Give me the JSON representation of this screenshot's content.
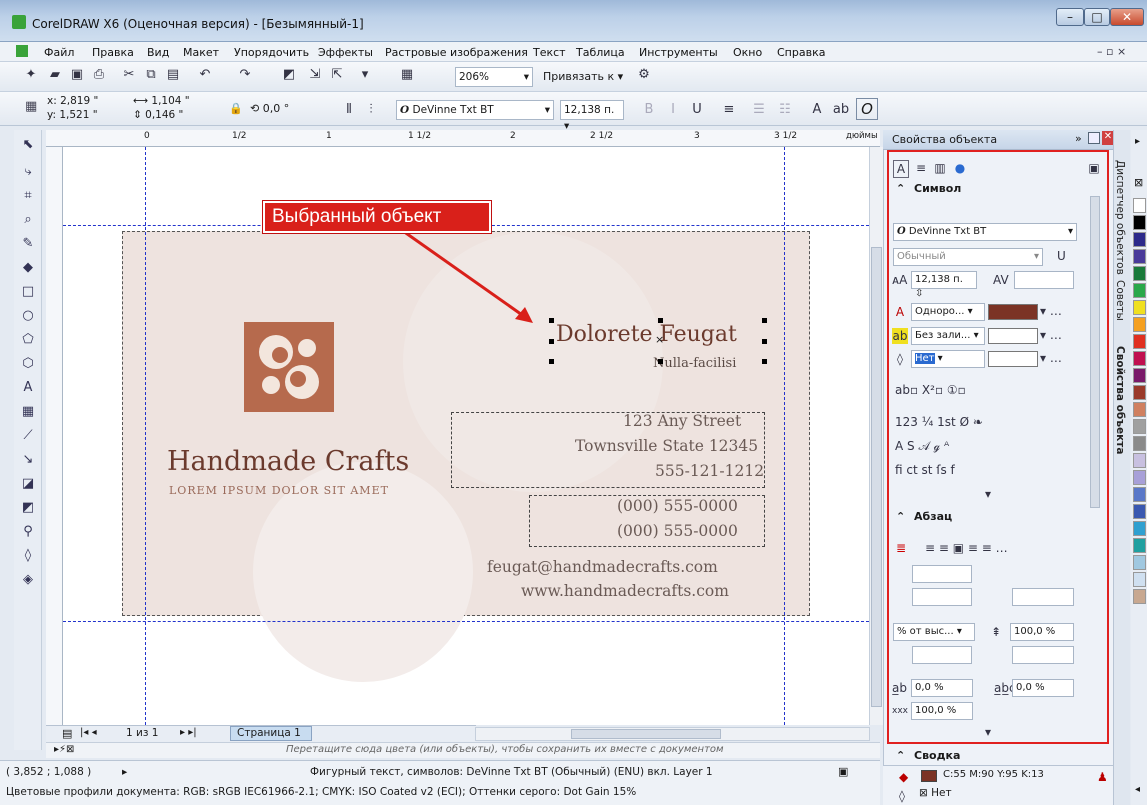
{
  "window": {
    "title": "CorelDRAW X6 (Оценочная версия) - [Безымянный-1]"
  },
  "menu": [
    "Файл",
    "Правка",
    "Вид",
    "Макет",
    "Упорядочить",
    "Эффекты",
    "Растровые изображения",
    "Текст",
    "Таблица",
    "Инструменты",
    "Окно",
    "Справка"
  ],
  "toolbar": {
    "zoom": "206%",
    "snap": "Привязать к"
  },
  "propbar": {
    "x": "x: 2,819 \"",
    "y": "y: 1,521 \"",
    "w": "1,104 \"",
    "h": "0,146 \"",
    "angle": "0,0",
    "font": "DeVinne Txt BT",
    "size": "12,138 п."
  },
  "ruler": {
    "units": "дюймы",
    "ticks": [
      "0",
      "1/2",
      "1",
      "1 1/2",
      "2",
      "2 1/2",
      "3",
      "3 1/2"
    ]
  },
  "card": {
    "name": "Dolorete Feugat",
    "tagline": "Nulla-facilisi",
    "brand": "Handmade Crafts",
    "brand_sub": "LOREM IPSUM DOLOR SIT AMET",
    "street": "123 Any Street",
    "city": "Townsville State 12345",
    "phone1": "555-121-1212",
    "phone2": "(000) 555-0000",
    "phone3": "(000) 555-0000",
    "email": "feugat@handmadecrafts.com",
    "web": "www.handmadecrafts.com"
  },
  "callout": "Выбранный объект",
  "pages": {
    "counter": "1 из 1",
    "tab": "Страница 1"
  },
  "palette_hint": "Перетащите сюда цвета (или объекты), чтобы сохранить их вместе с документом",
  "status": {
    "coords": "( 3,852 ; 1,088 )",
    "object": "Фигурный текст, символов: DeVinne Txt BT (Обычный) (ENU) вкл. Layer 1",
    "profiles": "Цветовые профили документа: RGB: sRGB IEC61966-2.1; CMYK: ISO Coated v2 (ECI); Оттенки серого: Dot Gain 15%",
    "fill": "C:55 M:90 Y:95 K:13",
    "outline": "Нет"
  },
  "panel": {
    "title": "Свойства объекта",
    "section_char": "Символ",
    "font": "DeVinne Txt BT",
    "style": "Обычный",
    "size": "12,138 п.",
    "fill_type": "Одноро...",
    "bg_type": "Без зали...",
    "outline_type": "Нет",
    "section_para": "Абзац",
    "para_align": "% от выс...",
    "para_spacing": "100,0 %",
    "char_spacing": "0,0 %",
    "word_spacing": "0,0 %",
    "lang_spacing": "100,0 %",
    "section_wrap": "Сводка",
    "fill_color": "#7b3325"
  },
  "sidetabs": [
    "Диспетчер объектов",
    "Советы",
    "Свойства объекта"
  ],
  "palette_colors": [
    "#ffffff",
    "#000000",
    "#2d2a8a",
    "#4a3a9a",
    "#1a7a3a",
    "#2aa84a",
    "#f0e020",
    "#f5a020",
    "#e03020",
    "#c01050",
    "#7a1a6a",
    "#9a3a2a",
    "#d08060",
    "#a0a0a0",
    "#8a8a8a",
    "#c8c0e0",
    "#a8a0d8",
    "#5a78c8",
    "#3a58b0",
    "#30a0d0",
    "#20a0a0",
    "#a0c8e0",
    "#d0e0f0",
    "#c8a890"
  ]
}
